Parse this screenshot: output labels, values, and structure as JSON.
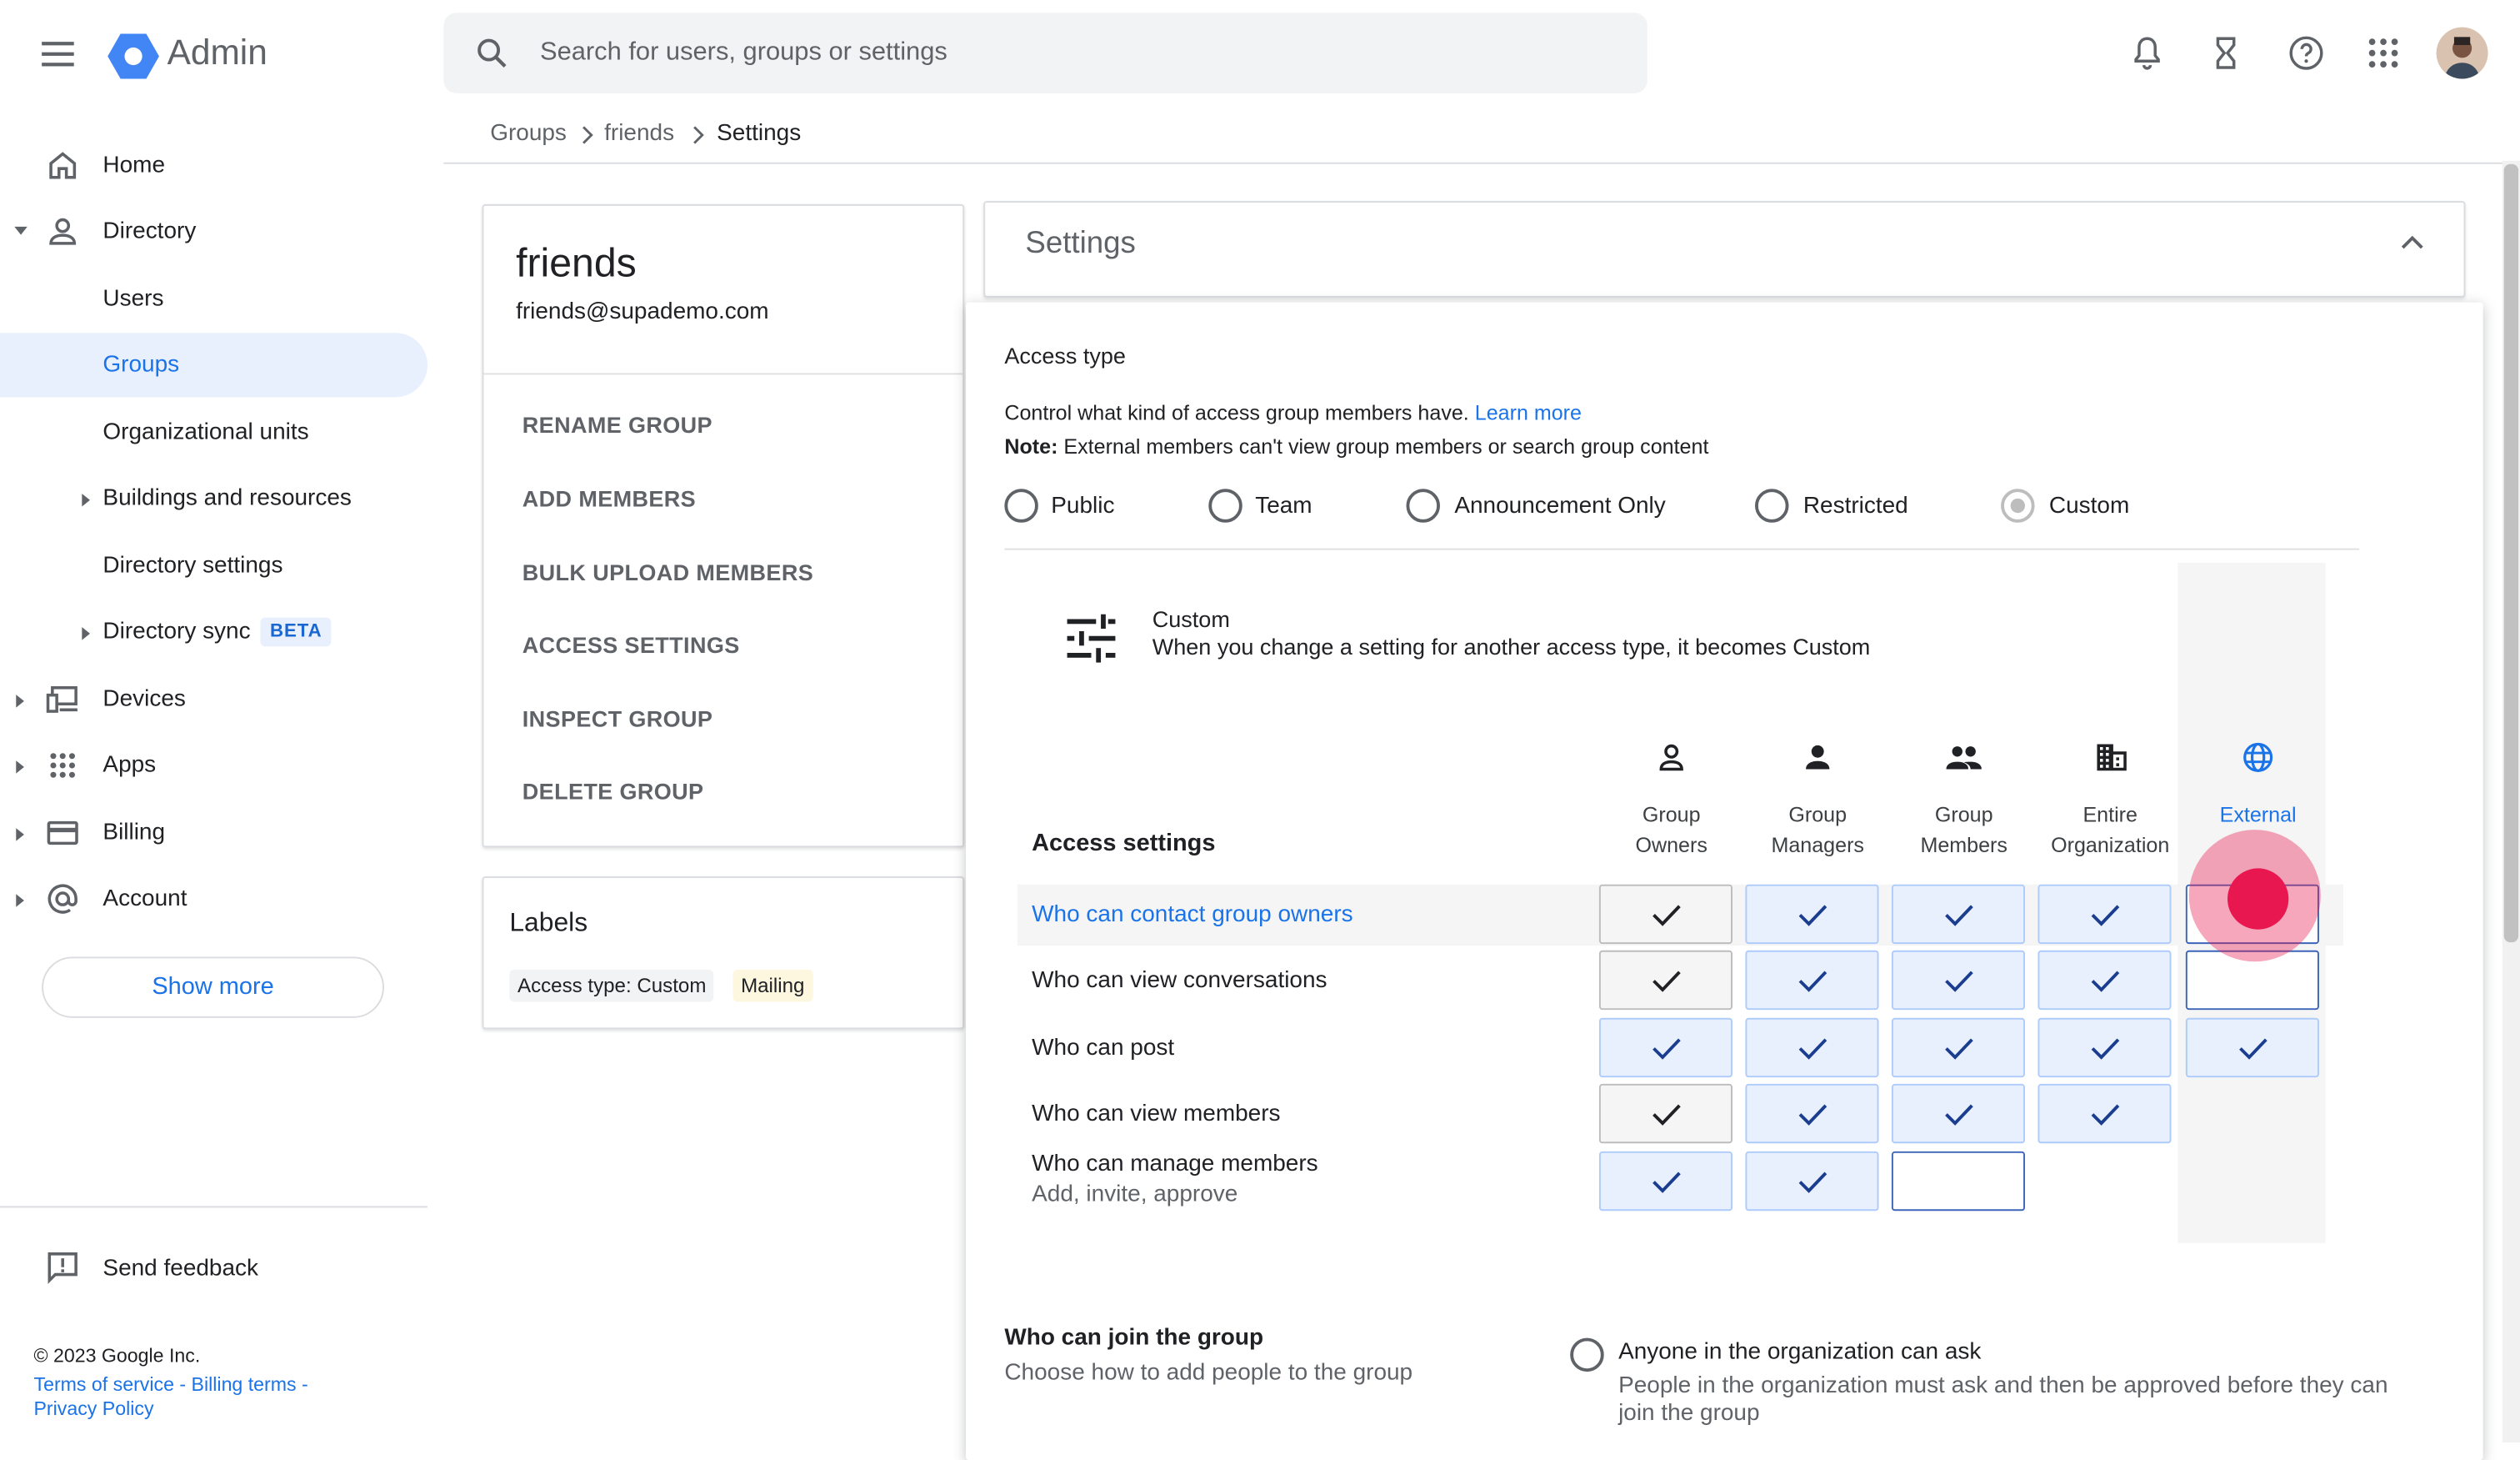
{
  "header": {
    "app_title": "Admin",
    "search_placeholder": "Search for users, groups or settings"
  },
  "sidebar": {
    "items": [
      {
        "label": "Home"
      },
      {
        "label": "Directory"
      },
      {
        "label": "Users"
      },
      {
        "label": "Groups"
      },
      {
        "label": "Organizational units"
      },
      {
        "label": "Buildings and resources"
      },
      {
        "label": "Directory settings"
      },
      {
        "label": "Directory sync",
        "badge": "BETA"
      },
      {
        "label": "Devices"
      },
      {
        "label": "Apps"
      },
      {
        "label": "Billing"
      },
      {
        "label": "Account"
      }
    ],
    "show_more": "Show more",
    "send_feedback": "Send feedback",
    "footer": {
      "copyright": "© 2023 Google Inc.",
      "terms": "Terms of service",
      "billing_terms": "Billing terms",
      "privacy": "Privacy Policy",
      "sep": " - "
    }
  },
  "breadcrumb": [
    "Groups",
    "friends",
    "Settings"
  ],
  "group": {
    "name": "friends",
    "email": "friends@supademo.com",
    "actions": [
      "RENAME GROUP",
      "ADD MEMBERS",
      "BULK UPLOAD MEMBERS",
      "ACCESS SETTINGS",
      "INSPECT GROUP",
      "DELETE GROUP"
    ],
    "labels_title": "Labels",
    "labels": [
      "Access type: Custom",
      "Mailing"
    ]
  },
  "settings": {
    "title": "Settings",
    "access_type_title": "Access type",
    "description": "Control what kind of access group members have.",
    "learn_more": "Learn more",
    "note_bold": "Note:",
    "note_text": "External members can't view group members or search group content",
    "access_types": [
      "Public",
      "Team",
      "Announcement Only",
      "Restricted",
      "Custom"
    ],
    "selected_access_type": "Custom",
    "custom_title": "Custom",
    "custom_desc": "When you change a setting for another access type, it becomes Custom",
    "access_settings_title": "Access settings",
    "columns": [
      {
        "line1": "Group",
        "line2": "Owners",
        "icon": "person-outline-icon"
      },
      {
        "line1": "Group",
        "line2": "Managers",
        "icon": "person-icon"
      },
      {
        "line1": "Group",
        "line2": "Members",
        "icon": "group-icon"
      },
      {
        "line1": "Entire",
        "line2": "Organization",
        "icon": "building-icon"
      },
      {
        "line1": "External",
        "line2": "",
        "icon": "globe-icon"
      }
    ],
    "rows": [
      {
        "label": "Who can contact group owners",
        "sub": "",
        "cells": [
          "locked",
          "on",
          "on",
          "on",
          "empty"
        ]
      },
      {
        "label": "Who can view conversations",
        "sub": "",
        "cells": [
          "locked",
          "on",
          "on",
          "on",
          "empty"
        ]
      },
      {
        "label": "Who can post",
        "sub": "",
        "cells": [
          "on",
          "on",
          "on",
          "on",
          "on"
        ]
      },
      {
        "label": "Who can view members",
        "sub": "",
        "cells": [
          "locked",
          "on",
          "on",
          "on",
          "none"
        ]
      },
      {
        "label": "Who can manage members",
        "sub": "Add, invite, approve",
        "cells": [
          "on",
          "on",
          "empty",
          "none",
          "none"
        ]
      }
    ],
    "join_title": "Who can join the group",
    "join_desc": "Choose how to add people to the group",
    "join_option": "Anyone in the organization can ask",
    "join_option_desc_1": "People in the organization must ask and then be approved before they can",
    "join_option_desc_2": "join the group"
  },
  "colors": {
    "accent": "#1a73e8",
    "highlight": "#e8f0fe",
    "cursor": "#e8174f"
  }
}
